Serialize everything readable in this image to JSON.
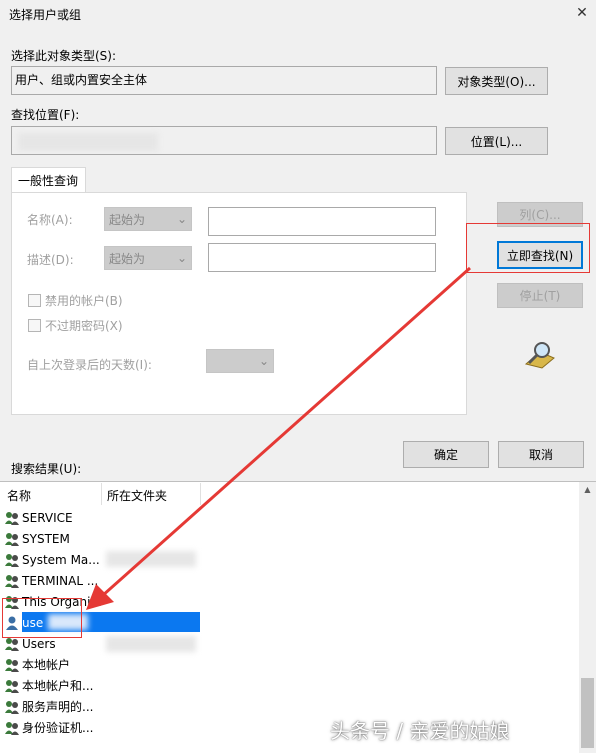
{
  "window": {
    "title": "选择用户或组",
    "close_glyph": "✕"
  },
  "object_type": {
    "label": "选择此对象类型(S):",
    "value": "用户、组或内置安全主体",
    "button": "对象类型(O)..."
  },
  "location": {
    "label": "查找位置(F):",
    "value": "",
    "button": "位置(L)..."
  },
  "tab": {
    "label": "一般性查询"
  },
  "query": {
    "name_label": "名称(A):",
    "name_mode": "起始为",
    "desc_label": "描述(D):",
    "desc_mode": "起始为",
    "disabled_accounts": "禁用的帐户(B)",
    "non_expiring_pw": "不过期密码(X)",
    "days_since_login": "自上次登录后的天数(I):"
  },
  "side_buttons": {
    "columns": "列(C)...",
    "find_now": "立即查找(N)",
    "stop": "停止(T)"
  },
  "actions": {
    "ok": "确定",
    "cancel": "取消"
  },
  "results": {
    "label": "搜索结果(U):",
    "headers": {
      "name": "名称",
      "folder": "所在文件夹"
    },
    "rows": [
      {
        "name": "SERVICE",
        "icon": "group-icon"
      },
      {
        "name": "SYSTEM",
        "icon": "group-icon"
      },
      {
        "name": "System Ma...",
        "icon": "group-icon"
      },
      {
        "name": "TERMINAL ...",
        "icon": "group-icon"
      },
      {
        "name": "This Organi...",
        "icon": "group-icon"
      },
      {
        "name": "use",
        "icon": "user-icon",
        "selected": true
      },
      {
        "name": "Users",
        "icon": "group-icon"
      },
      {
        "name": "本地帐户",
        "icon": "group-icon"
      },
      {
        "name": "本地帐户和...",
        "icon": "group-icon"
      },
      {
        "name": "服务声明的...",
        "icon": "group-icon"
      },
      {
        "name": "身份验证机...",
        "icon": "group-icon"
      }
    ]
  },
  "watermark": "头条号 / 亲爱的姑娘",
  "colors": {
    "highlight": "#e53935",
    "selection": "#0b78f0",
    "accent": "#0078d7"
  }
}
